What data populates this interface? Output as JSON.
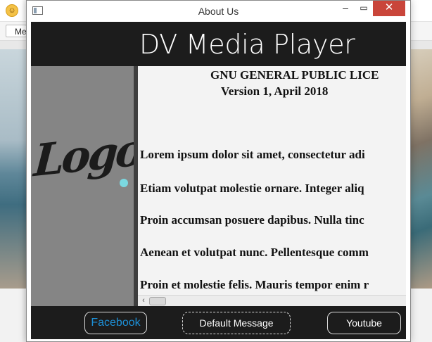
{
  "background_app": {
    "menu_label": "Me"
  },
  "dialog": {
    "title": "About Us",
    "controls": {
      "minimize": "–",
      "maximize": "▭",
      "close": "✕"
    }
  },
  "header": {
    "app_name": "DV Media Player"
  },
  "logo": {
    "text": "Logo",
    "dot_color": "#7bd8e0"
  },
  "license": {
    "title": "GNU GENERAL PUBLIC LICE",
    "version": "Version 1, April 2018",
    "paragraphs": [
      "Lorem ipsum dolor sit amet, consectetur adi",
      "Etiam volutpat molestie ornare. Integer aliq",
      "Proin accumsan posuere dapibus. Nulla tinc",
      "Aenean et volutpat nunc. Pellentesque comm",
      "Proin et molestie felis. Mauris tempor enim r"
    ]
  },
  "footer": {
    "facebook_label": "Facebook",
    "default_label": "Default Message",
    "youtube_label": "Youtube"
  },
  "colors": {
    "dark_bg": "#1c1c1c",
    "logo_panel": "#858585",
    "close_button": "#c9453a",
    "facebook_text": "#1d8fd6"
  }
}
